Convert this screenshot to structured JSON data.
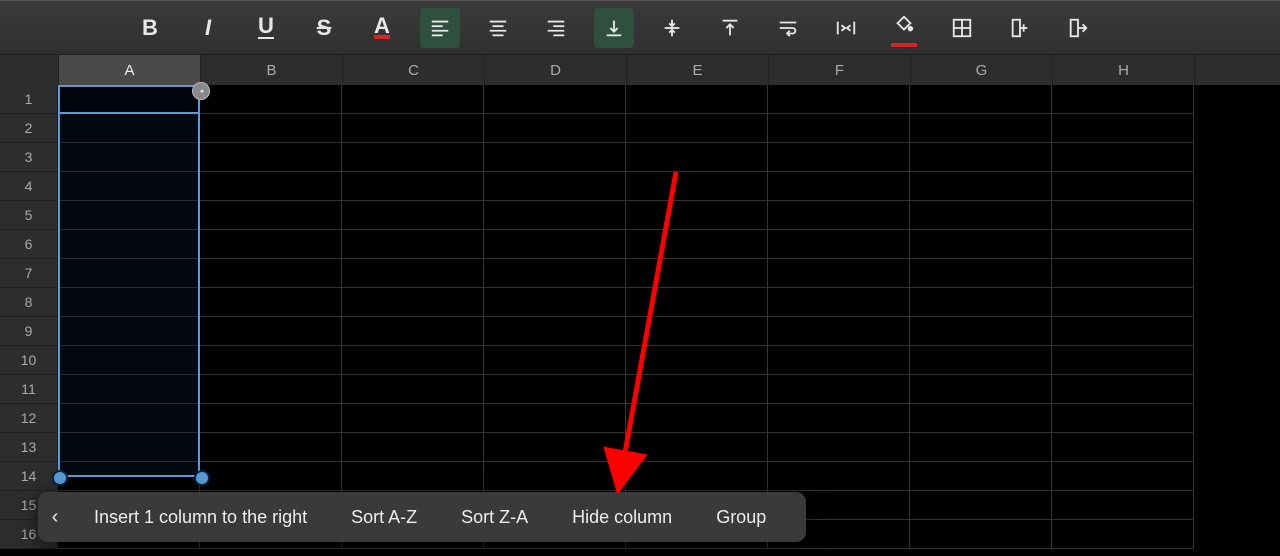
{
  "toolbar": {
    "buttons": [
      {
        "name": "bold-button",
        "glyph": "B"
      },
      {
        "name": "italic-button",
        "glyph": "I"
      },
      {
        "name": "underline-button",
        "glyph": "U"
      },
      {
        "name": "strikethrough-button",
        "glyph": "S"
      },
      {
        "name": "text-color-button",
        "glyph": "A"
      },
      {
        "name": "align-left-button"
      },
      {
        "name": "align-center-button"
      },
      {
        "name": "align-right-button"
      },
      {
        "name": "valign-bottom-button"
      },
      {
        "name": "valign-middle-button"
      },
      {
        "name": "valign-top-button"
      },
      {
        "name": "wrap-text-button"
      },
      {
        "name": "merge-cells-button"
      },
      {
        "name": "fill-color-button"
      },
      {
        "name": "borders-button"
      },
      {
        "name": "insert-column-button"
      },
      {
        "name": "delete-column-button"
      }
    ],
    "active_align": "align-left-button",
    "active_valign": "valign-bottom-button"
  },
  "columns": [
    "A",
    "B",
    "C",
    "D",
    "E",
    "F",
    "G",
    "H"
  ],
  "rows": [
    "1",
    "2",
    "3",
    "4",
    "5",
    "6",
    "7",
    "8",
    "9",
    "10",
    "11",
    "12",
    "13",
    "14",
    "15",
    "16"
  ],
  "selected_column_index": 0,
  "context_menu": {
    "back_icon": "‹",
    "items": [
      "Insert 1 column to the right",
      "Sort A-Z",
      "Sort Z-A",
      "Hide column",
      "Group"
    ]
  }
}
